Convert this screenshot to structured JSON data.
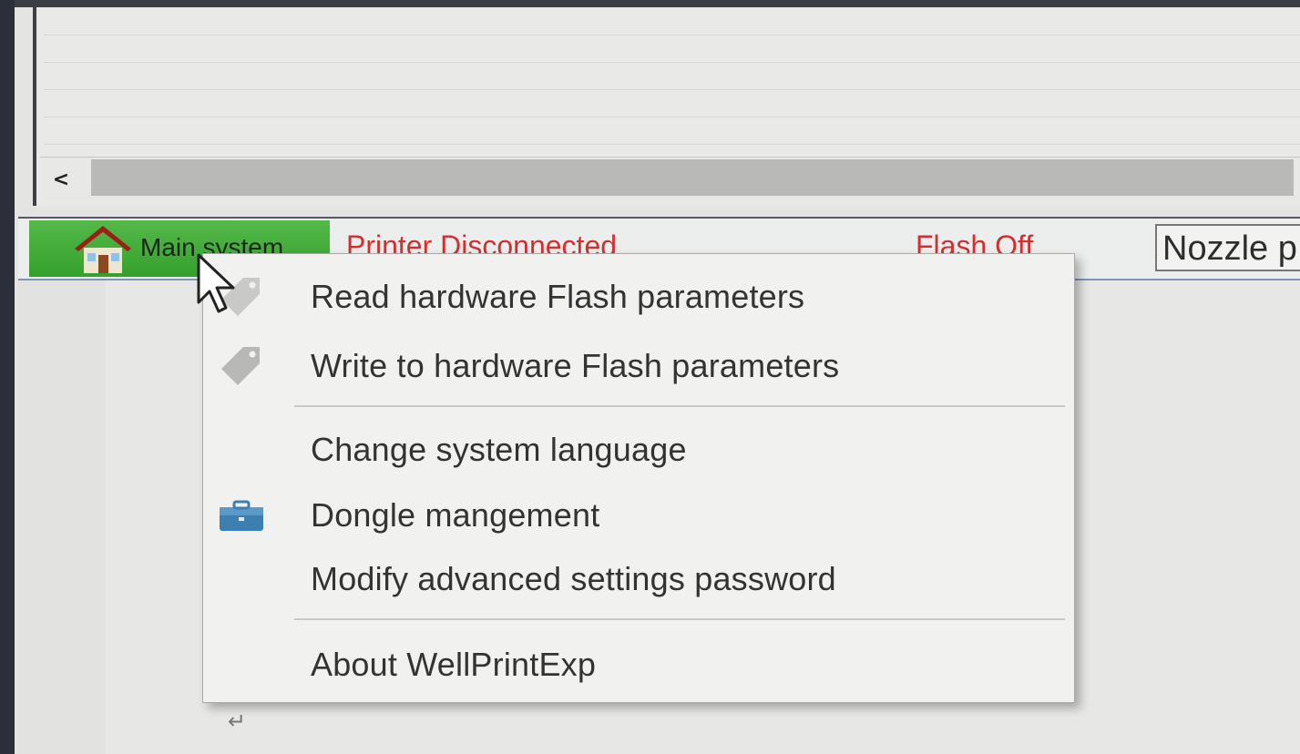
{
  "status_bar": {
    "main_system_label": "Main system",
    "printer_status": "Printer Disconnected",
    "flash_status": "Flash Off",
    "nozzle_label": "Nozzle p"
  },
  "context_menu": {
    "items": [
      {
        "label": "Read hardware Flash parameters",
        "icon": "tag-icon"
      },
      {
        "label": "Write to hardware Flash parameters",
        "icon": "tag-icon"
      },
      {
        "label": "Change system language",
        "icon": ""
      },
      {
        "label": "Dongle mangement",
        "icon": "briefcase-icon"
      },
      {
        "label": "Modify advanced settings password",
        "icon": ""
      },
      {
        "label": "About WellPrintExp",
        "icon": ""
      }
    ]
  },
  "scrollbar": {
    "left_arrow": "<"
  },
  "colors": {
    "main_button_green": "#3aa532",
    "status_red": "#d13030",
    "menu_background": "#f1f1ef"
  }
}
